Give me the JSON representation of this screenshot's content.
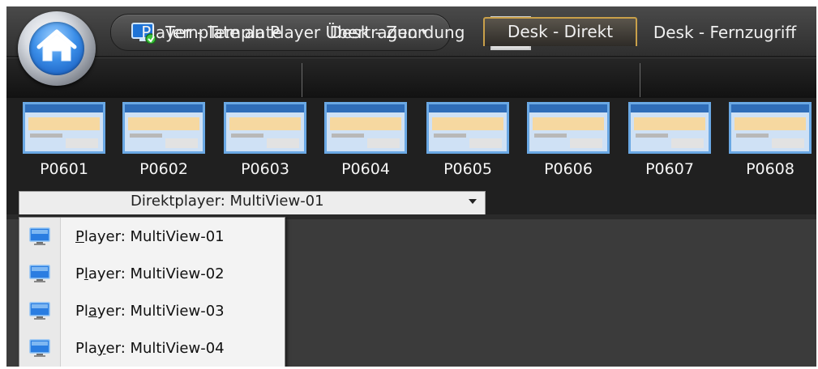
{
  "quick_access": {
    "label": "Template an Player Übertragen",
    "arrow": "▾"
  },
  "tabs": [
    {
      "label": "Player - Template"
    },
    {
      "label": "Desk - Zuordung"
    },
    {
      "label": "Desk - Direkt",
      "active": true
    },
    {
      "label": "Desk - Fernzugriff"
    }
  ],
  "players": [
    "P0601",
    "P0602",
    "P0603",
    "P0604",
    "P0605",
    "P0606",
    "P0607",
    "P0608"
  ],
  "dropdown": {
    "value": "Direktplayer: MultiView-01"
  },
  "menu": {
    "items": [
      {
        "pre": "",
        "mn": "P",
        "post": "layer: MultiView-01"
      },
      {
        "pre": "P",
        "mn": "l",
        "post": "ayer: MultiView-02"
      },
      {
        "pre": "Pl",
        "mn": "a",
        "post": "yer: MultiView-03"
      },
      {
        "pre": "Pla",
        "mn": "y",
        "post": "er: MultiView-04"
      }
    ]
  },
  "colors": {
    "accent": "#c9a04a",
    "background": "#3b3b3b",
    "home_blue": "#3b8ee8"
  },
  "icons": {
    "home": "home-icon",
    "quick_access": "monitor-transfer-icon",
    "preview": "eye-icon",
    "menu_item": "monitor-icon"
  }
}
